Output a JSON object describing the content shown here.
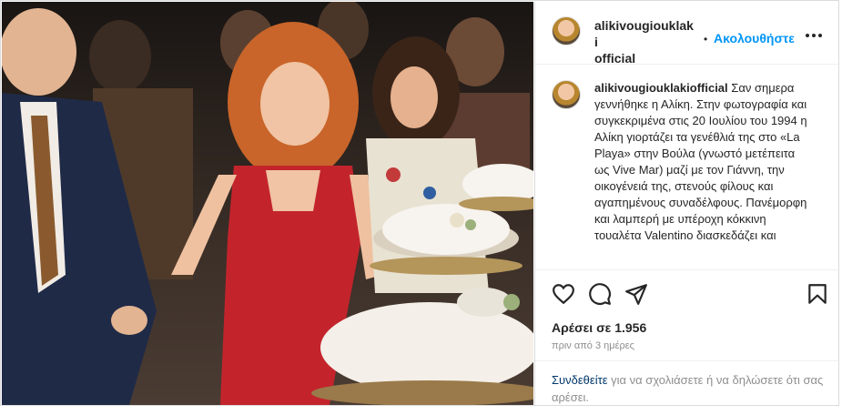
{
  "post": {
    "username": "alikivougiouklakiofficial",
    "username_line1": "alikivougiouklaki",
    "username_line2": "official",
    "dot": "•",
    "follow_label": "Ακολουθήστε",
    "caption_text": "Σαν σημερα γεννήθηκε η Αλίκη. Στην φωτογραφία και συγκεκριμένα στις 20 Ιουλίου του 1994 η Αλίκη γιορτάζει τα γενέθλιά της στο «La Playa» στην Βούλα (γνωστό μετέπειτα ως Vive Mar) μαζί με τον Γιάννη, την οικογένειά της, στενούς φίλους και αγαπημένους συναδέλφους. Πανέμορφη και λαμπερή με υπέροχη κόκκινη τουαλέτα Valentino διασκεδάζει και",
    "likes": "Αρέσει σε 1.956",
    "time_ago": "πριν από 3 ημέρες",
    "login_link": "Συνδεθείτε",
    "login_rest": "για να σχολιάσετε ή να δηλώσετε ότι σας αρέσει."
  },
  "icons": {
    "more": "more-options-icon",
    "like": "heart-icon",
    "comment": "comment-icon",
    "share": "share-icon",
    "save": "bookmark-icon"
  },
  "colors": {
    "accent": "#0095f6",
    "link": "#00376b",
    "muted": "#8e8e8e",
    "text": "#262626"
  }
}
